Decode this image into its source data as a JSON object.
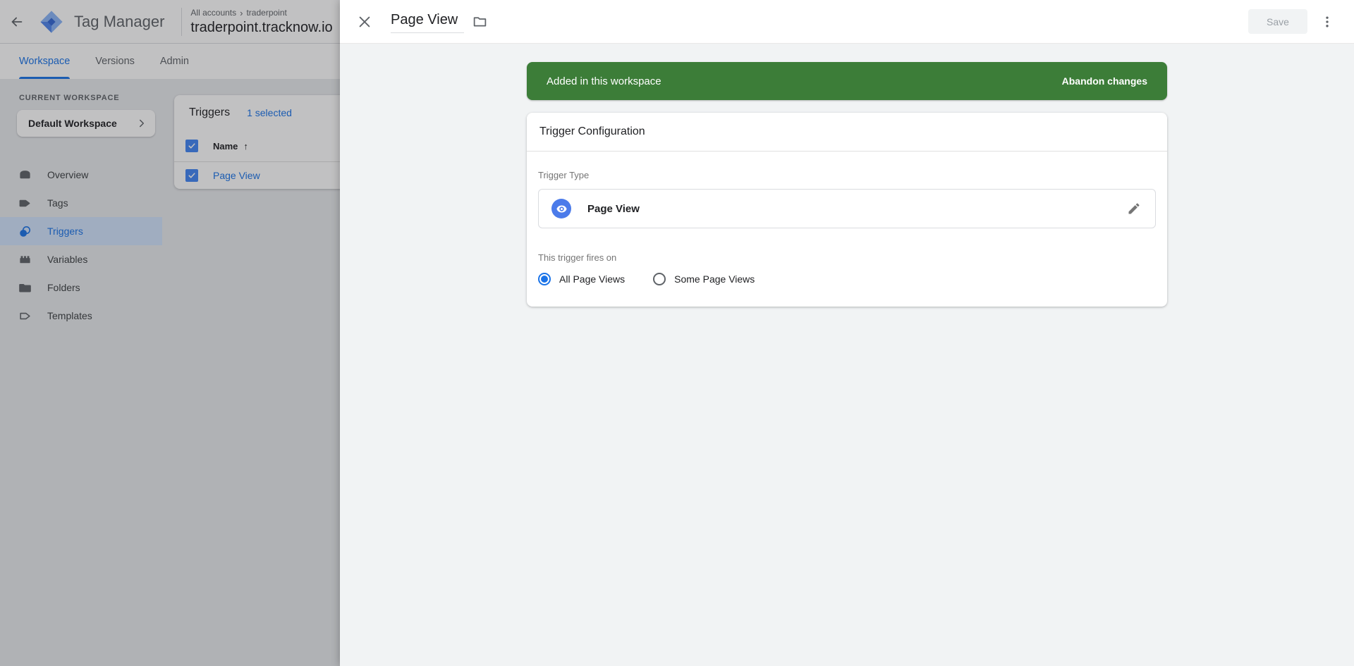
{
  "topbar": {
    "app_title": "Tag Manager",
    "breadcrumb_root": "All accounts",
    "breadcrumb_separator": "›",
    "breadcrumb_account": "traderpoint",
    "container_name": "traderpoint.tracknow.io"
  },
  "tabs": [
    {
      "label": "Workspace"
    },
    {
      "label": "Versions"
    },
    {
      "label": "Admin"
    }
  ],
  "sidebar": {
    "section_label": "CURRENT WORKSPACE",
    "workspace_name": "Default Workspace",
    "items": [
      {
        "label": "Overview"
      },
      {
        "label": "Tags"
      },
      {
        "label": "Triggers"
      },
      {
        "label": "Variables"
      },
      {
        "label": "Folders"
      },
      {
        "label": "Templates"
      }
    ]
  },
  "content": {
    "heading": "Triggers",
    "selected_count": "1 selected",
    "table": {
      "name_column": "Name",
      "sort_arrow": "↑",
      "rows": [
        {
          "name": "Page View"
        }
      ]
    }
  },
  "panel": {
    "title": "Page View",
    "save_label": "Save",
    "banner": {
      "message": "Added in this workspace",
      "action_label": "Abandon changes"
    },
    "config": {
      "title": "Trigger Configuration",
      "type_label": "Trigger Type",
      "type_value": "Page View",
      "fires_label": "This trigger fires on",
      "options": [
        {
          "label": "All Page Views",
          "selected": true
        },
        {
          "label": "Some Page Views",
          "selected": false
        }
      ]
    }
  },
  "colors": {
    "accent_blue": "#1a73e8",
    "checkbox_blue": "#4285f4",
    "banner_green": "#3c7d38",
    "trigger_icon_blue": "#4b7bea"
  }
}
